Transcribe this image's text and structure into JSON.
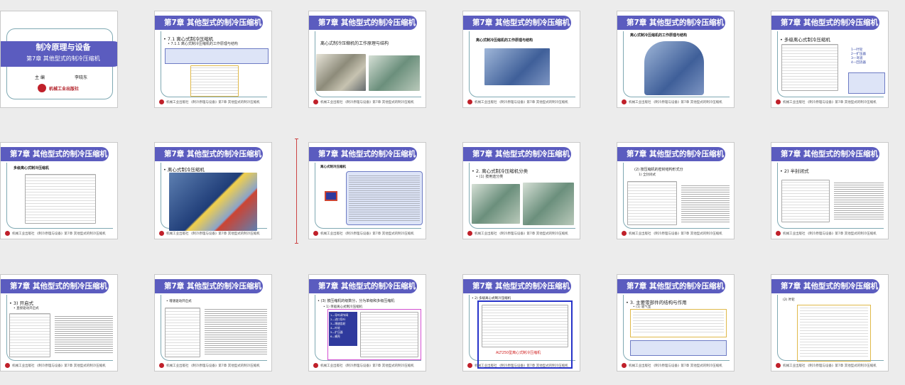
{
  "colors": {
    "title_bar": "#5b5cbf",
    "frame_line": "#7fa9b3",
    "selection_marker": "#cc4444",
    "logo": "#c0202a"
  },
  "footer_text": "机械工业出版社  《制冷原理与设备》第7章 其他型式的制冷压缩机",
  "cover": {
    "title": "制冷原理与设备",
    "subtitle": "第7章 其他型式的制冷压缩机",
    "author_label": "主 编",
    "author_name": "李晓东",
    "publisher": "机械工业出版社"
  },
  "chapter_title": "第7章 其他型式的制冷压缩机",
  "slides": [
    {
      "heading": "",
      "sub": ""
    },
    {
      "heading": "• 7.1  离心式制冷压缩机",
      "sub": "• 7.1.1 离心式制冷压缩机的工作原理与结构"
    },
    {
      "heading": "离心式制冷压缩机的工作原理与结构",
      "sub": ""
    },
    {
      "heading": "离心式制冷压缩机的工作原理与结构",
      "sub": ""
    },
    {
      "heading": "离心式制冷压缩机的工作原理与结构",
      "sub": ""
    },
    {
      "heading": "• 多级离心式制冷压缩机",
      "sub": ""
    },
    {
      "heading": "多级离心式制冷压缩机",
      "sub": ""
    },
    {
      "heading": "• 离心式制冷压缩机",
      "sub": ""
    },
    {
      "heading": "离心式制冷压缩机",
      "sub": ""
    },
    {
      "heading": "• 2. 离心式制冷压缩机分类",
      "sub": "• (1) 按用途分类"
    },
    {
      "heading": "(2) 按压缩机的密封结构形式分",
      "sub": "1) 全封闭式"
    },
    {
      "heading": "• 2) 半封闭式",
      "sub": ""
    },
    {
      "heading": "• 3) 开启式",
      "sub": "• 直接驱动开启式"
    },
    {
      "heading": "• 增速驱动开启式",
      "sub": ""
    },
    {
      "heading": "• (3) 按压缩机的级数分，分为单级和多级压缩机",
      "sub": "• 1) 单级离心式制冷压缩机"
    },
    {
      "heading": "• 2) 多级离心式制冷压缩机",
      "sub": ""
    },
    {
      "heading": "• 3. 主要零部件的结构与作用",
      "sub": "• (1) 吸气室"
    },
    {
      "heading": "(2) 叶轮",
      "sub": ""
    }
  ],
  "labels": {
    "legend_stages": "1—叶轮\n2—扩压器\n3—弯道\n4—回流器",
    "s9_box": "离心式冷水机组",
    "s15_caption": "ALT250型离心式制冷压缩机",
    "s14_legend": "1—导叶调节阀\n2—进口导叶\n3—增速齿轮\n4—叶轮\n5—扩压器\n6—蜗壳"
  }
}
